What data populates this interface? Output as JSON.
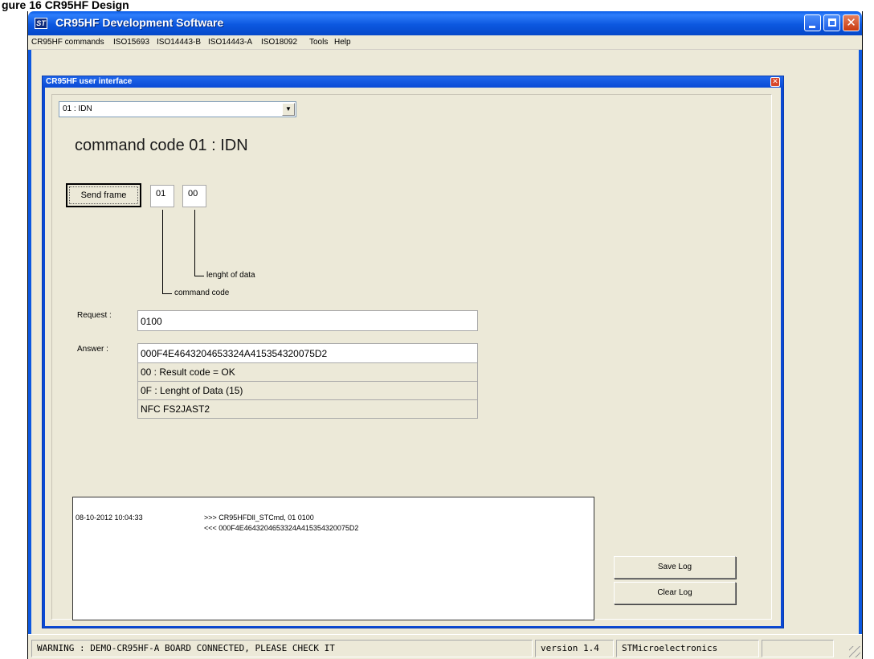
{
  "caption": "gure 16 CR95HF Design",
  "window": {
    "title": "CR95HF Development Software",
    "icon_text": "ST"
  },
  "menu": [
    "CR95HF commands",
    "ISO15693",
    "ISO14443-B",
    "ISO14443-A",
    "ISO18092",
    "Tools",
    "Help"
  ],
  "dialog": {
    "title": "CR95HF user interface",
    "command_select": "01 : IDN",
    "command_title": "command code 01 : IDN",
    "send_label": "Send frame",
    "hex_cmd": "01",
    "hex_len": "00",
    "label_length": "lenght of data",
    "label_command": "command code",
    "request_label": "Request :",
    "request_value": "0100",
    "answer_label": "Answer :",
    "answer_value": "000F4E4643204653324A415354320075D2",
    "result_code": "00 : Result code = OK",
    "data_length": "0F : Lenght of Data (15)",
    "decoded": "NFC FS2JAST2"
  },
  "log": {
    "timestamp": "08-10-2012 10:04:33",
    "line1": ">>> CR95HFDll_STCmd, 01 0100",
    "line2": "<<< 000F4E4643204653324A415354320075D2",
    "save_label": "Save Log",
    "clear_label": "Clear Log"
  },
  "status": {
    "warning": "WARNING : DEMO-CR95HF-A BOARD CONNECTED, PLEASE CHECK IT",
    "version": "version 1.4",
    "vendor": "STMicroelectronics"
  }
}
